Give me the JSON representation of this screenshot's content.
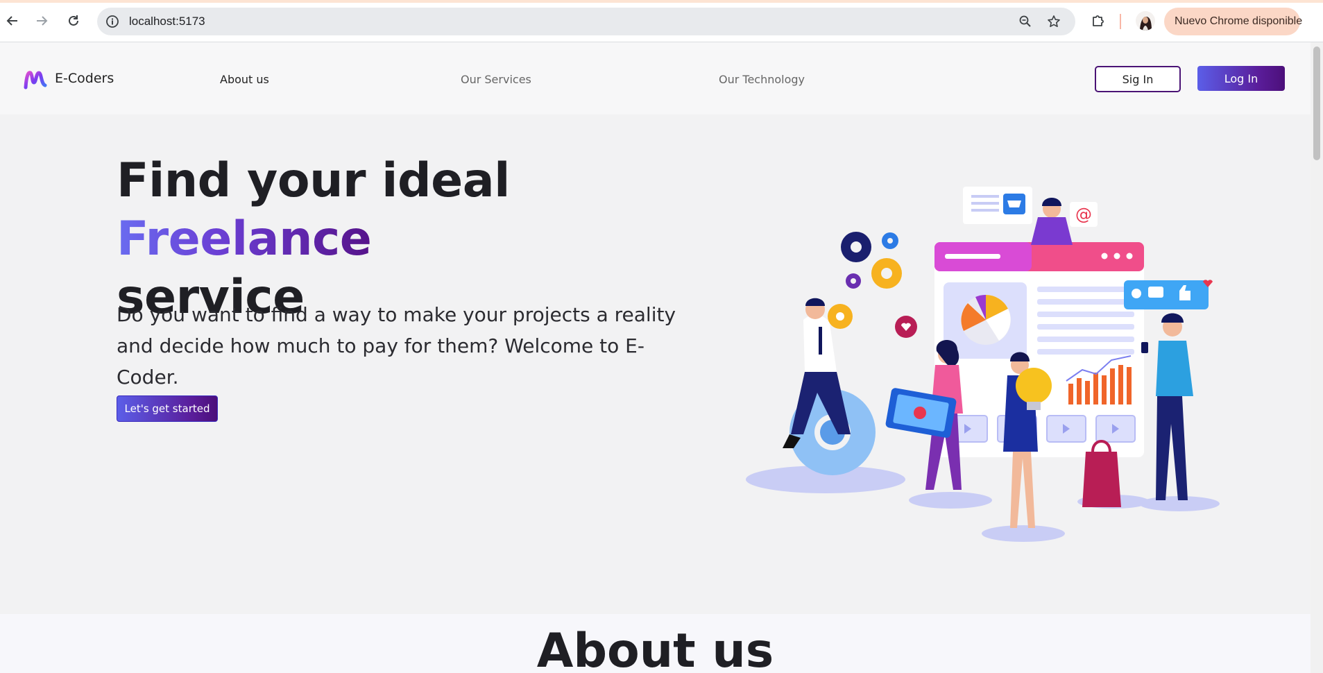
{
  "browser": {
    "url": "localhost:5173",
    "update_label": "Nuevo Chrome disponible",
    "icons": {
      "back": "arrow-left-icon",
      "forward": "arrow-right-icon",
      "reload": "reload-icon",
      "site_info": "info-icon",
      "zoom": "zoom-icon",
      "bookmark": "star-icon",
      "extensions": "puzzle-icon",
      "menu": "kebab-menu-icon"
    }
  },
  "site": {
    "brand": "E-Coders",
    "nav": {
      "about": "About us",
      "services": "Our Services",
      "technology": "Our Technology"
    },
    "sign_in": "Sig In",
    "log_in": "Log In"
  },
  "hero": {
    "title_pre": "Find your ideal ",
    "title_accent": "Freelance",
    "title_post": "service",
    "subtitle": "Do you want to find a way to make your projects a reality and decide how much to pay for them? Welcome to E-Coder.",
    "cta": "Let's get started"
  },
  "about": {
    "title": "About us"
  },
  "colors": {
    "accent_start": "#5b5ee8",
    "accent_end": "#4c0f7a",
    "page_bg": "#f2f2f3",
    "nav_bg": "#f7f7f8"
  }
}
